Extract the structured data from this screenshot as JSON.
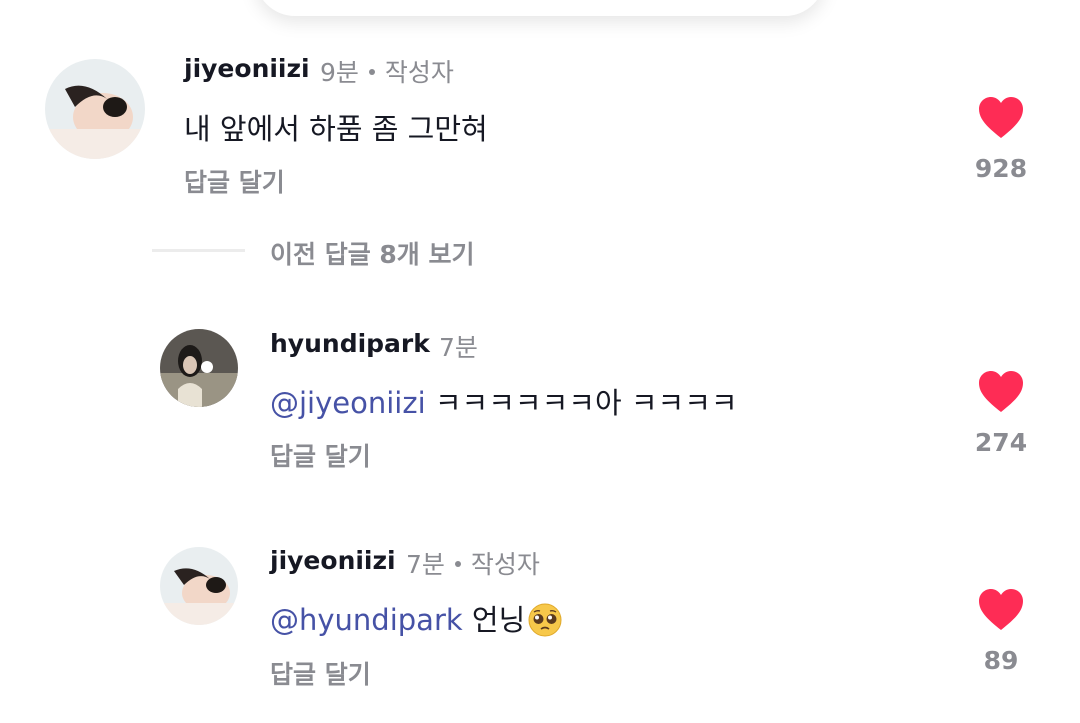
{
  "comments": [
    {
      "username": "jiyeoniizi",
      "time": "9분",
      "author_label": "작성자",
      "text": "내 앞에서 하품 좀 그만혀",
      "reply_label": "답글 달기",
      "likes": "928"
    }
  ],
  "replies_toggle": {
    "label": "이전 답글 8개 보기"
  },
  "replies": [
    {
      "username": "hyundipark",
      "time": "7분",
      "mention": "@jiyeoniizi",
      "text": " ㅋㅋㅋㅋㅋㅋ아 ㅋㅋㅋㅋ",
      "reply_label": "답글 달기",
      "likes": "274"
    },
    {
      "username": "jiyeoniizi",
      "time": "7분",
      "author_label": "작성자",
      "mention": "@hyundipark",
      "text": " 언닝",
      "emoji": "pleading-face-icon",
      "reply_label": "답글 달기",
      "likes": "89"
    }
  ],
  "colors": {
    "heart": "#fe2c55",
    "mention": "#4652a6",
    "secondary_text": "#8a8b91"
  }
}
